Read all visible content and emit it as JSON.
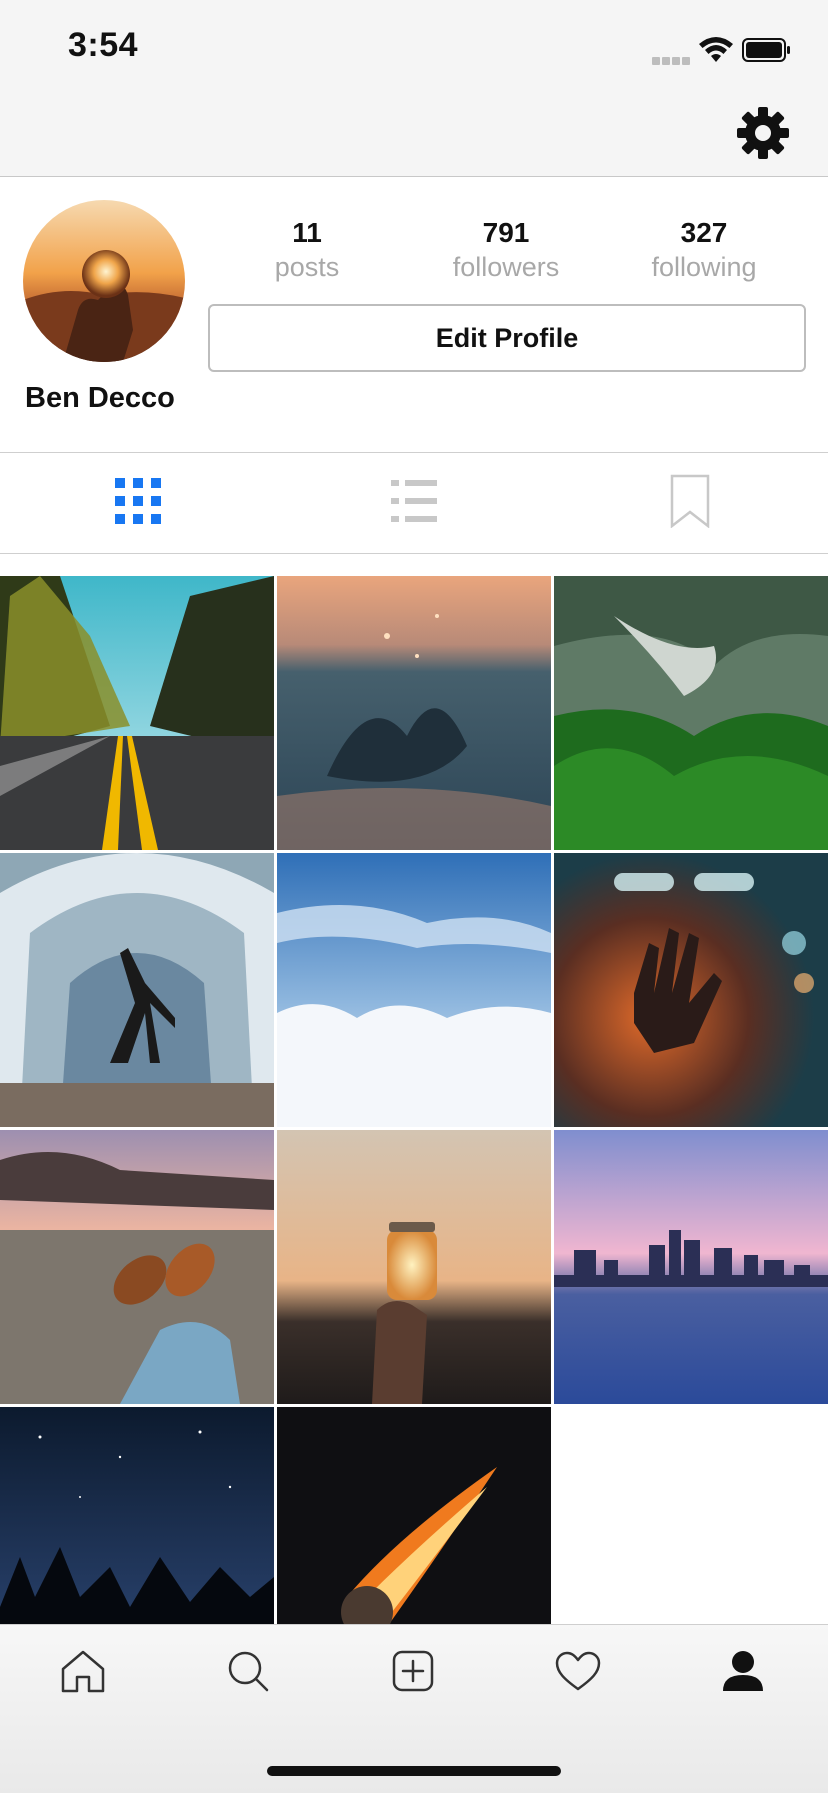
{
  "status_bar": {
    "time": "3:54"
  },
  "header": {
    "settings_icon": "gear-icon"
  },
  "profile": {
    "name": "Ben Decco",
    "stats": [
      {
        "value": "11",
        "label": "posts"
      },
      {
        "value": "791",
        "label": "followers"
      },
      {
        "value": "327",
        "label": "following"
      }
    ],
    "edit_button": "Edit Profile"
  },
  "tabs": [
    {
      "icon": "grid-icon",
      "active": true
    },
    {
      "icon": "list-icon",
      "active": false
    },
    {
      "icon": "bookmark-icon",
      "active": false
    }
  ],
  "posts": [
    {
      "subject": "forest road"
    },
    {
      "subject": "water splash"
    },
    {
      "subject": "misty green hills"
    },
    {
      "subject": "dancer in fountain tunnel"
    },
    {
      "subject": "clouds and blue sky"
    },
    {
      "subject": "hand on wet glass"
    },
    {
      "subject": "feet by lake at sunset"
    },
    {
      "subject": "glowing jar in hand"
    },
    {
      "subject": "city skyline at dusk"
    },
    {
      "subject": "milky way over trees"
    },
    {
      "subject": "burning dandelion"
    }
  ],
  "bottom_nav": [
    {
      "icon": "home-icon"
    },
    {
      "icon": "search-icon"
    },
    {
      "icon": "add-post-icon"
    },
    {
      "icon": "heart-icon"
    },
    {
      "icon": "profile-icon",
      "active": true
    }
  ],
  "colors": {
    "accent": "#1877f2",
    "muted": "#a8a8a8",
    "border": "#bdbdbd"
  }
}
